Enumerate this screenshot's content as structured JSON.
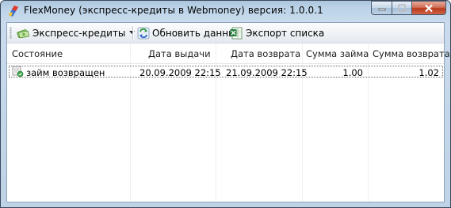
{
  "window": {
    "title": "FlexMoney (экспресс-кредиты в Webmoney) версия: 1.0.0.1"
  },
  "toolbar": {
    "express_label": "Экспресс-кредиты",
    "refresh_label": "Обновить данные",
    "export_label": "Экспорт списка"
  },
  "table": {
    "columns": [
      "Состояние",
      "Дата выдачи",
      "Дата возврата",
      "Сумма займа",
      "Сумма возврата"
    ],
    "rows": [
      {
        "status": "займ возвращен",
        "issue_date": "20.09.2009 22:15",
        "return_date": "21.09.2009 22:15",
        "loan_amount": "1.00",
        "return_amount": "1.02"
      }
    ]
  }
}
